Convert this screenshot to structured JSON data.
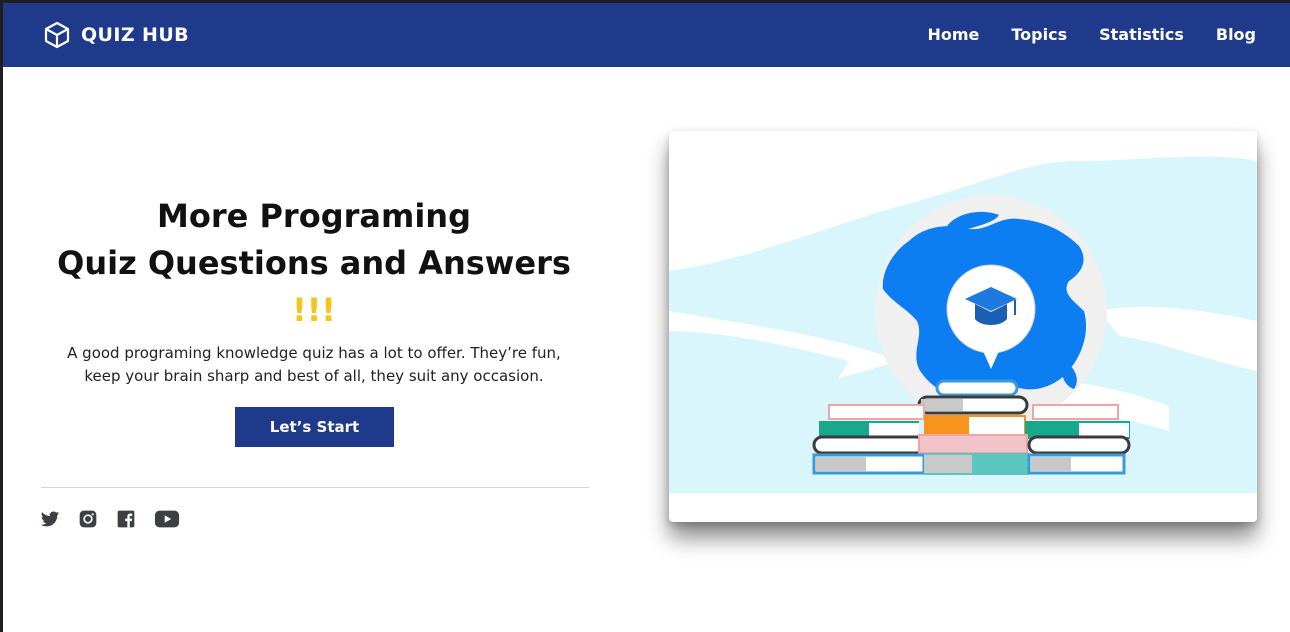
{
  "brand": {
    "name": "QUIZ HUB",
    "icon": "cube-icon"
  },
  "nav": {
    "links": [
      {
        "label": "Home"
      },
      {
        "label": "Topics"
      },
      {
        "label": "Statistics"
      },
      {
        "label": "Blog"
      }
    ]
  },
  "hero": {
    "title_line1": "More Programing",
    "title_line2": "Quiz Questions and Answers",
    "title_emphasis": "!!!",
    "subtitle": "A good programing knowledge quiz has a lot to offer. They’re fun, keep your brain sharp and best of all, they suit any occasion.",
    "cta_label": "Let’s Start"
  },
  "social": {
    "icons": [
      "twitter-icon",
      "instagram-icon",
      "facebook-icon",
      "youtube-icon"
    ]
  },
  "illustration": {
    "subject": "globe-with-graduation-cap-on-books",
    "colors": {
      "globe_land": "#0d7ef2",
      "background_wave": "#d8f6fb",
      "cap": "#1f7ae0"
    }
  },
  "colors": {
    "navbar_bg": "#1f3a8a",
    "button_bg": "#1f3a8a",
    "accent_yellow": "#f5c518",
    "text_dark": "#111111"
  }
}
